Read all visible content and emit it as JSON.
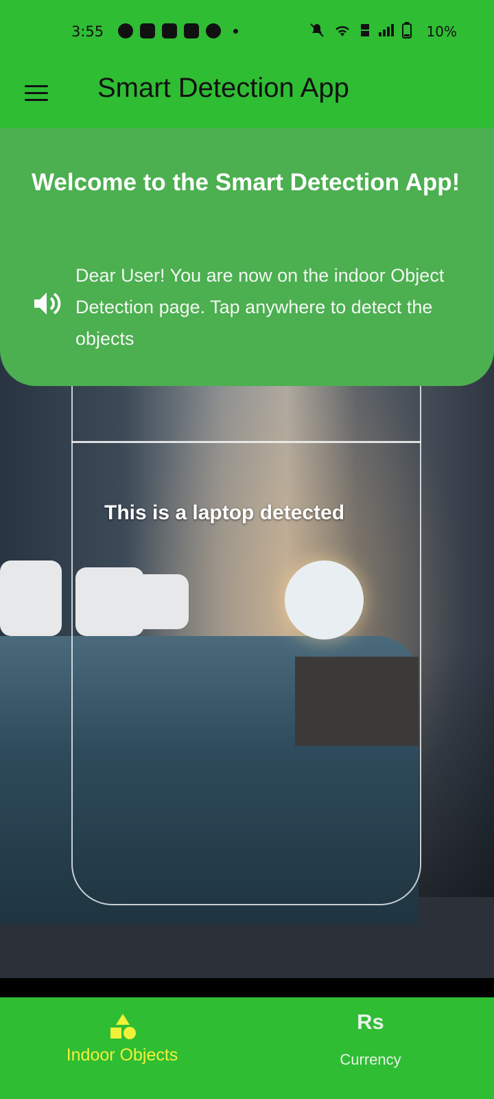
{
  "status_bar": {
    "time": "3:55",
    "battery": "10%",
    "icons_left": [
      "whatsapp-icon",
      "game-icon",
      "youtube-icon",
      "app-icon",
      "extra-icon"
    ],
    "icons_right": [
      "mute-icon",
      "wifi-icon",
      "volte-icon",
      "signal-icon",
      "battery-icon"
    ]
  },
  "app_bar": {
    "title": "Smart Detection App",
    "menu_icon": "hamburger-menu-icon"
  },
  "welcome": {
    "title": "Welcome to the Smart Detection App!",
    "message": "Dear User! You are now on the indoor Object Detection page. Tap anywhere to detect the objects",
    "speaker_icon": "speaker-icon"
  },
  "camera": {
    "detection_label": "This is a laptop detected"
  },
  "bottom_nav": {
    "items": [
      {
        "label": "Indoor Objects",
        "icon": "shapes-icon",
        "active": true,
        "color": "#f1f13a"
      },
      {
        "label": "Currency",
        "icon_text": "Rs",
        "active": false,
        "color": "#e8f2e8"
      }
    ]
  },
  "colors": {
    "primary": "#2fbd34",
    "card": "#4caf50"
  }
}
